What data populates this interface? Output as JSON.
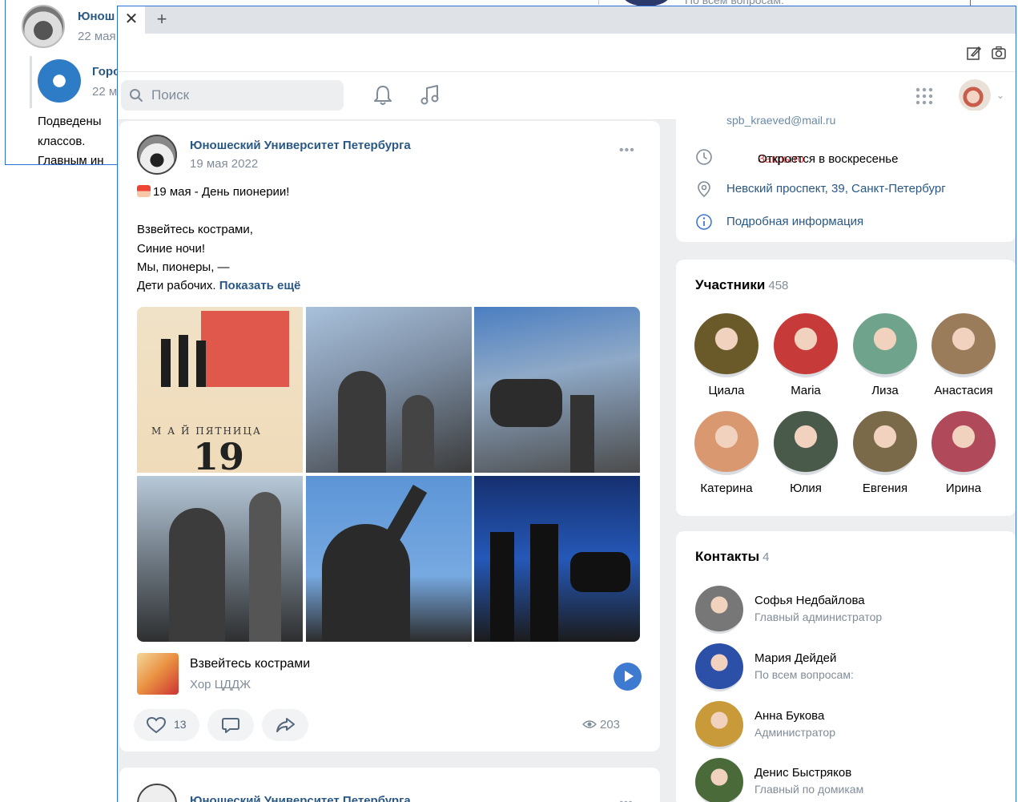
{
  "background_window": {
    "post1": {
      "author": "Юнош",
      "date": "22 мая"
    },
    "post2": {
      "author": "Горо",
      "date": "22 м"
    },
    "text_lines": [
      "Подведены",
      "классов.",
      "Главным ин"
    ],
    "top_contact_role": "По всем вопросам:"
  },
  "browser": {
    "close_tab": "✕",
    "new_tab": "+"
  },
  "header": {
    "search_placeholder": "Поиск"
  },
  "post": {
    "author": "Юношеский Университет Петербурга",
    "date": "19 мая 2022",
    "lines": [
      "19 мая - День пионерии!",
      "Взвейтесь кострами,",
      "Синие ночи!",
      "Мы, пионеры, —",
      "Дети рабочих."
    ],
    "show_more": "Показать ещё",
    "more": "•••",
    "poster": {
      "word": "М А Й      ПЯТНИЦА",
      "number": "19"
    },
    "audio": {
      "title": "Взвейтесь кострами",
      "artist": "Хор ЦДДЖ"
    },
    "likes": "13",
    "views": "203"
  },
  "post2": {
    "author": "Юношеский Университет Петербурга",
    "more": "•••"
  },
  "info": {
    "email": "spb_kraeved@mail.ru",
    "status_closed": "Закрыто",
    "status_sep": " · ",
    "status_opens": "Откроется в воскресенье",
    "address": "Невский проспект, 39, Санкт-Петербург",
    "details": "Подробная информация"
  },
  "members": {
    "title": "Участники",
    "count": "458",
    "items": [
      {
        "name": "Циала",
        "color": "#6a5a2a"
      },
      {
        "name": "Maria",
        "color": "#c73a3a"
      },
      {
        "name": "Лиза",
        "color": "#6fa38b"
      },
      {
        "name": "Анастасия",
        "color": "#9a7b5a"
      },
      {
        "name": "Катерина",
        "color": "#d99870"
      },
      {
        "name": "Юлия",
        "color": "#4a5a4a"
      },
      {
        "name": "Евгения",
        "color": "#7a6a4a"
      },
      {
        "name": "Ирина",
        "color": "#b04a5a"
      }
    ]
  },
  "contacts": {
    "title": "Контакты",
    "count": "4",
    "items": [
      {
        "name": "Софья Недбайлова",
        "role": "Главный администратор",
        "color": "#777777"
      },
      {
        "name": "Мария Дейдей",
        "role": "По всем вопросам:",
        "color": "#2c4fa8"
      },
      {
        "name": "Анна Букова",
        "role": "Администратор",
        "color": "#c99a3a"
      },
      {
        "name": "Денис Быстряков",
        "role": "Главный по домикам",
        "color": "#4a6a3a"
      }
    ]
  },
  "colors": {
    "link": "#2a5885",
    "accent": "#3f7ad1",
    "closed": "#e64646",
    "window_border": "#2c6fd6"
  }
}
